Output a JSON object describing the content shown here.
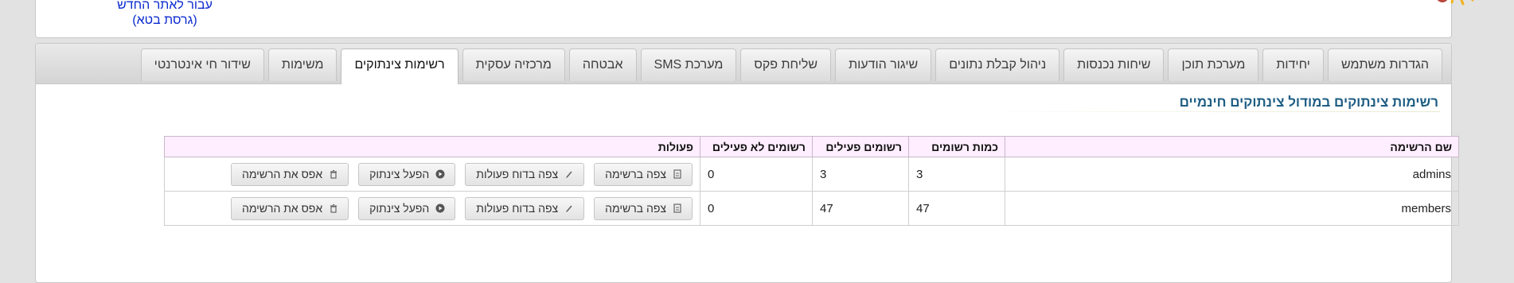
{
  "header": {
    "new_site_link": "עבור לאתר החדש (גרסת בטא)"
  },
  "tabs": [
    {
      "label": "הגדרות משתמש",
      "active": false
    },
    {
      "label": "יחידות",
      "active": false
    },
    {
      "label": "מערכת תוכן",
      "active": false
    },
    {
      "label": "שיחות נכנסות",
      "active": false
    },
    {
      "label": "ניהול קבלת נתונים",
      "active": false
    },
    {
      "label": "שיגור הודעות",
      "active": false
    },
    {
      "label": "שליחת פקס",
      "active": false
    },
    {
      "label": "מערכת SMS",
      "active": false
    },
    {
      "label": "אבטחה",
      "active": false
    },
    {
      "label": "מרכזיה עסקית",
      "active": false
    },
    {
      "label": "רשימות צינתוקים",
      "active": true
    },
    {
      "label": "משימות",
      "active": false
    },
    {
      "label": "שידור חי אינטרנטי",
      "active": false
    }
  ],
  "section_title": "רשימות צינתוקים במודול צינתוקים חינמיים",
  "table": {
    "headers": {
      "name": "שם הרשימה",
      "count": "כמות רשומים",
      "active": "רשומים פעילים",
      "inactive": "רשומים לא פעילים",
      "actions": "פעולות"
    },
    "rows": [
      {
        "name": "admins",
        "count": "3",
        "active": "3",
        "inactive": "0"
      },
      {
        "name": "members",
        "count": "47",
        "active": "47",
        "inactive": "0"
      }
    ],
    "buttons": {
      "view": "צפה ברשימה",
      "report": "צפה בדוח פעולות",
      "run": "הפעל צינתוק",
      "reset": "אפס את הרשימה"
    }
  },
  "colors": {
    "active_count": "#2e8b2e",
    "inactive_count": "#dd0000",
    "title": "#1e5d83",
    "link": "#0c2bd0"
  }
}
